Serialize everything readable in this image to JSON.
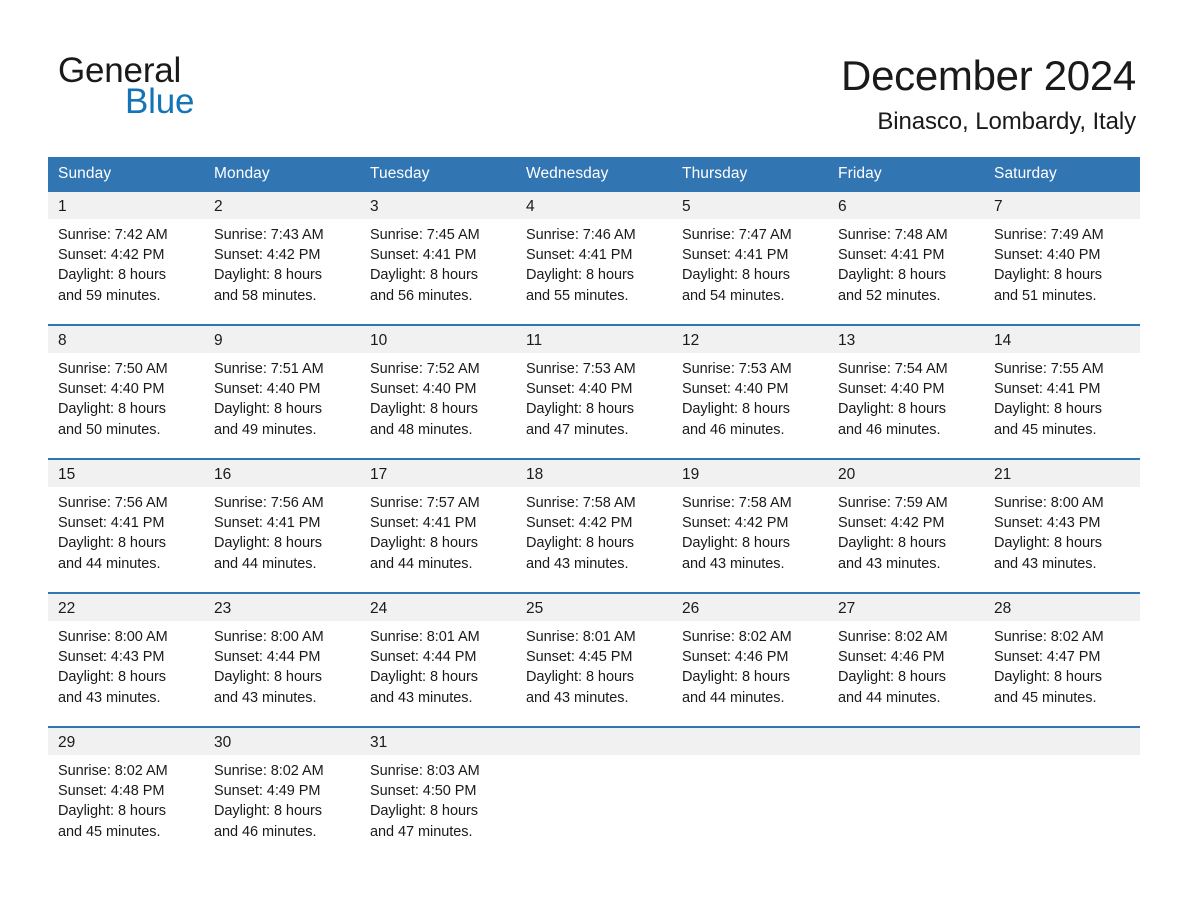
{
  "brand": {
    "name_part1": "General",
    "name_part2": "Blue",
    "triangle_color": "#1574b7",
    "accent_color": "#3275b3"
  },
  "header": {
    "title": "December 2024",
    "location": "Binasco, Lombardy, Italy"
  },
  "weekday_headers": [
    "Sunday",
    "Monday",
    "Tuesday",
    "Wednesday",
    "Thursday",
    "Friday",
    "Saturday"
  ],
  "weeks": [
    [
      {
        "date": "1",
        "sunrise": "Sunrise: 7:42 AM",
        "sunset": "Sunset: 4:42 PM",
        "daylight_line1": "Daylight: 8 hours",
        "daylight_line2": "and 59 minutes."
      },
      {
        "date": "2",
        "sunrise": "Sunrise: 7:43 AM",
        "sunset": "Sunset: 4:42 PM",
        "daylight_line1": "Daylight: 8 hours",
        "daylight_line2": "and 58 minutes."
      },
      {
        "date": "3",
        "sunrise": "Sunrise: 7:45 AM",
        "sunset": "Sunset: 4:41 PM",
        "daylight_line1": "Daylight: 8 hours",
        "daylight_line2": "and 56 minutes."
      },
      {
        "date": "4",
        "sunrise": "Sunrise: 7:46 AM",
        "sunset": "Sunset: 4:41 PM",
        "daylight_line1": "Daylight: 8 hours",
        "daylight_line2": "and 55 minutes."
      },
      {
        "date": "5",
        "sunrise": "Sunrise: 7:47 AM",
        "sunset": "Sunset: 4:41 PM",
        "daylight_line1": "Daylight: 8 hours",
        "daylight_line2": "and 54 minutes."
      },
      {
        "date": "6",
        "sunrise": "Sunrise: 7:48 AM",
        "sunset": "Sunset: 4:41 PM",
        "daylight_line1": "Daylight: 8 hours",
        "daylight_line2": "and 52 minutes."
      },
      {
        "date": "7",
        "sunrise": "Sunrise: 7:49 AM",
        "sunset": "Sunset: 4:40 PM",
        "daylight_line1": "Daylight: 8 hours",
        "daylight_line2": "and 51 minutes."
      }
    ],
    [
      {
        "date": "8",
        "sunrise": "Sunrise: 7:50 AM",
        "sunset": "Sunset: 4:40 PM",
        "daylight_line1": "Daylight: 8 hours",
        "daylight_line2": "and 50 minutes."
      },
      {
        "date": "9",
        "sunrise": "Sunrise: 7:51 AM",
        "sunset": "Sunset: 4:40 PM",
        "daylight_line1": "Daylight: 8 hours",
        "daylight_line2": "and 49 minutes."
      },
      {
        "date": "10",
        "sunrise": "Sunrise: 7:52 AM",
        "sunset": "Sunset: 4:40 PM",
        "daylight_line1": "Daylight: 8 hours",
        "daylight_line2": "and 48 minutes."
      },
      {
        "date": "11",
        "sunrise": "Sunrise: 7:53 AM",
        "sunset": "Sunset: 4:40 PM",
        "daylight_line1": "Daylight: 8 hours",
        "daylight_line2": "and 47 minutes."
      },
      {
        "date": "12",
        "sunrise": "Sunrise: 7:53 AM",
        "sunset": "Sunset: 4:40 PM",
        "daylight_line1": "Daylight: 8 hours",
        "daylight_line2": "and 46 minutes."
      },
      {
        "date": "13",
        "sunrise": "Sunrise: 7:54 AM",
        "sunset": "Sunset: 4:40 PM",
        "daylight_line1": "Daylight: 8 hours",
        "daylight_line2": "and 46 minutes."
      },
      {
        "date": "14",
        "sunrise": "Sunrise: 7:55 AM",
        "sunset": "Sunset: 4:41 PM",
        "daylight_line1": "Daylight: 8 hours",
        "daylight_line2": "and 45 minutes."
      }
    ],
    [
      {
        "date": "15",
        "sunrise": "Sunrise: 7:56 AM",
        "sunset": "Sunset: 4:41 PM",
        "daylight_line1": "Daylight: 8 hours",
        "daylight_line2": "and 44 minutes."
      },
      {
        "date": "16",
        "sunrise": "Sunrise: 7:56 AM",
        "sunset": "Sunset: 4:41 PM",
        "daylight_line1": "Daylight: 8 hours",
        "daylight_line2": "and 44 minutes."
      },
      {
        "date": "17",
        "sunrise": "Sunrise: 7:57 AM",
        "sunset": "Sunset: 4:41 PM",
        "daylight_line1": "Daylight: 8 hours",
        "daylight_line2": "and 44 minutes."
      },
      {
        "date": "18",
        "sunrise": "Sunrise: 7:58 AM",
        "sunset": "Sunset: 4:42 PM",
        "daylight_line1": "Daylight: 8 hours",
        "daylight_line2": "and 43 minutes."
      },
      {
        "date": "19",
        "sunrise": "Sunrise: 7:58 AM",
        "sunset": "Sunset: 4:42 PM",
        "daylight_line1": "Daylight: 8 hours",
        "daylight_line2": "and 43 minutes."
      },
      {
        "date": "20",
        "sunrise": "Sunrise: 7:59 AM",
        "sunset": "Sunset: 4:42 PM",
        "daylight_line1": "Daylight: 8 hours",
        "daylight_line2": "and 43 minutes."
      },
      {
        "date": "21",
        "sunrise": "Sunrise: 8:00 AM",
        "sunset": "Sunset: 4:43 PM",
        "daylight_line1": "Daylight: 8 hours",
        "daylight_line2": "and 43 minutes."
      }
    ],
    [
      {
        "date": "22",
        "sunrise": "Sunrise: 8:00 AM",
        "sunset": "Sunset: 4:43 PM",
        "daylight_line1": "Daylight: 8 hours",
        "daylight_line2": "and 43 minutes."
      },
      {
        "date": "23",
        "sunrise": "Sunrise: 8:00 AM",
        "sunset": "Sunset: 4:44 PM",
        "daylight_line1": "Daylight: 8 hours",
        "daylight_line2": "and 43 minutes."
      },
      {
        "date": "24",
        "sunrise": "Sunrise: 8:01 AM",
        "sunset": "Sunset: 4:44 PM",
        "daylight_line1": "Daylight: 8 hours",
        "daylight_line2": "and 43 minutes."
      },
      {
        "date": "25",
        "sunrise": "Sunrise: 8:01 AM",
        "sunset": "Sunset: 4:45 PM",
        "daylight_line1": "Daylight: 8 hours",
        "daylight_line2": "and 43 minutes."
      },
      {
        "date": "26",
        "sunrise": "Sunrise: 8:02 AM",
        "sunset": "Sunset: 4:46 PM",
        "daylight_line1": "Daylight: 8 hours",
        "daylight_line2": "and 44 minutes."
      },
      {
        "date": "27",
        "sunrise": "Sunrise: 8:02 AM",
        "sunset": "Sunset: 4:46 PM",
        "daylight_line1": "Daylight: 8 hours",
        "daylight_line2": "and 44 minutes."
      },
      {
        "date": "28",
        "sunrise": "Sunrise: 8:02 AM",
        "sunset": "Sunset: 4:47 PM",
        "daylight_line1": "Daylight: 8 hours",
        "daylight_line2": "and 45 minutes."
      }
    ],
    [
      {
        "date": "29",
        "sunrise": "Sunrise: 8:02 AM",
        "sunset": "Sunset: 4:48 PM",
        "daylight_line1": "Daylight: 8 hours",
        "daylight_line2": "and 45 minutes."
      },
      {
        "date": "30",
        "sunrise": "Sunrise: 8:02 AM",
        "sunset": "Sunset: 4:49 PM",
        "daylight_line1": "Daylight: 8 hours",
        "daylight_line2": "and 46 minutes."
      },
      {
        "date": "31",
        "sunrise": "Sunrise: 8:03 AM",
        "sunset": "Sunset: 4:50 PM",
        "daylight_line1": "Daylight: 8 hours",
        "daylight_line2": "and 47 minutes."
      },
      {
        "date": "",
        "sunrise": "",
        "sunset": "",
        "daylight_line1": "",
        "daylight_line2": ""
      },
      {
        "date": "",
        "sunrise": "",
        "sunset": "",
        "daylight_line1": "",
        "daylight_line2": ""
      },
      {
        "date": "",
        "sunrise": "",
        "sunset": "",
        "daylight_line1": "",
        "daylight_line2": ""
      },
      {
        "date": "",
        "sunrise": "",
        "sunset": "",
        "daylight_line1": "",
        "daylight_line2": ""
      }
    ]
  ]
}
